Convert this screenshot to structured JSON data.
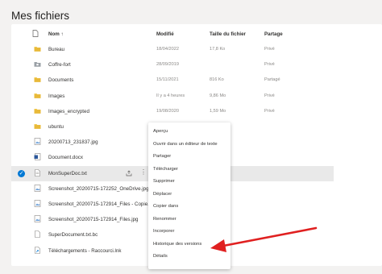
{
  "page_title": "Mes fichiers",
  "columns": {
    "name": "Nom",
    "sort_arrow": "↑",
    "modified": "Modifié",
    "size": "Taille du fichier",
    "sharing": "Partage"
  },
  "rows": [
    {
      "name": "Bureau",
      "modified": "18/04/2022",
      "size": "17,8 Ko",
      "sharing": "Privé",
      "icon": "folder-icon"
    },
    {
      "name": "Coffre-fort",
      "modified": "28/09/2019",
      "size": "",
      "sharing": "Privé",
      "icon": "vault-icon"
    },
    {
      "name": "Documents",
      "modified": "15/11/2021",
      "size": "816 Ko",
      "sharing": "Partagé",
      "icon": "folder-icon"
    },
    {
      "name": "Images",
      "modified": "Il y a 4 heures",
      "size": "9,86 Mo",
      "sharing": "Privé",
      "icon": "folder-icon"
    },
    {
      "name": "Images_encrypted",
      "modified": "19/08/2020",
      "size": "1,59 Mo",
      "sharing": "Privé",
      "icon": "folder-icon"
    },
    {
      "name": "ubuntu",
      "modified": "",
      "size": "",
      "sharing": "",
      "icon": "folder-icon"
    },
    {
      "name": "20200713_231837.jpg",
      "modified": "",
      "size": "",
      "sharing": "",
      "icon": "image-file-icon"
    },
    {
      "name": "Document.docx",
      "modified": "",
      "size": "",
      "sharing": "",
      "icon": "word-file-icon"
    },
    {
      "name": "MonSuperDoc.txt",
      "modified": "",
      "size": "",
      "sharing": "",
      "icon": "text-file-icon",
      "selected": true
    },
    {
      "name": "Screenshot_20200715-172252_OneDrive.jpg",
      "modified": "",
      "size": "",
      "sharing": "",
      "icon": "image-file-icon"
    },
    {
      "name": "Screenshot_20200715-172914_Files - Copie...",
      "modified": "",
      "size": "",
      "sharing": "",
      "icon": "image-file-icon"
    },
    {
      "name": "Screenshot_20200715-172914_Files.jpg",
      "modified": "",
      "size": "",
      "sharing": "",
      "icon": "image-file-icon"
    },
    {
      "name": "SuperDocument.txt.bc",
      "modified": "",
      "size": "",
      "sharing": "",
      "icon": "file-icon"
    },
    {
      "name": "Téléchargements - Raccourci.lnk",
      "modified": "",
      "size": "",
      "sharing": "",
      "icon": "shortcut-file-icon"
    }
  ],
  "context_menu": [
    "Aperçu",
    "Ouvrir dans un éditeur de texte",
    "Partager",
    "Télécharger",
    "Supprimer",
    "Déplacer",
    "Copier dans",
    "Renommer",
    "Incorporer",
    "Historique des versions",
    "Détails"
  ],
  "colors": {
    "accent": "#0078d4",
    "folder": "#f2c94c",
    "arrow": "#e02020"
  }
}
